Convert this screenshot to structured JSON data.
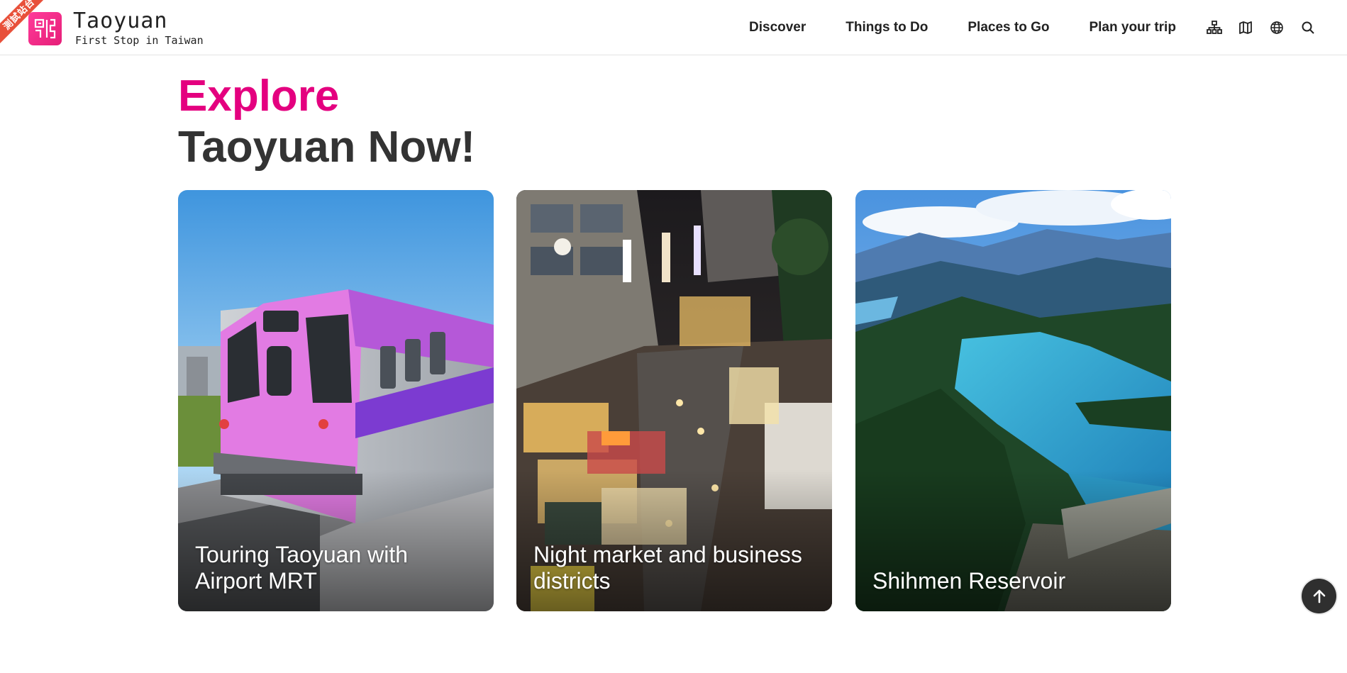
{
  "ribbon_text": "測試站台",
  "brand": {
    "title": "Taoyuan",
    "tagline": "First Stop in Taiwan"
  },
  "nav": {
    "items": [
      {
        "label": "Discover"
      },
      {
        "label": "Things to Do"
      },
      {
        "label": "Places to Go"
      },
      {
        "label": "Plan your trip"
      }
    ],
    "icons": [
      "sitemap-icon",
      "map-icon",
      "globe-icon",
      "search-icon"
    ]
  },
  "hero": {
    "line1": "Explore",
    "line2": "Taoyuan Now!"
  },
  "cards": [
    {
      "label": "Touring Taoyuan with Airport MRT"
    },
    {
      "label": "Night market and business districts"
    },
    {
      "label": "Shihmen Reservoir"
    }
  ],
  "colors": {
    "accent": "#e4007f",
    "heading": "#333333",
    "ribbon": "#e8503a"
  }
}
